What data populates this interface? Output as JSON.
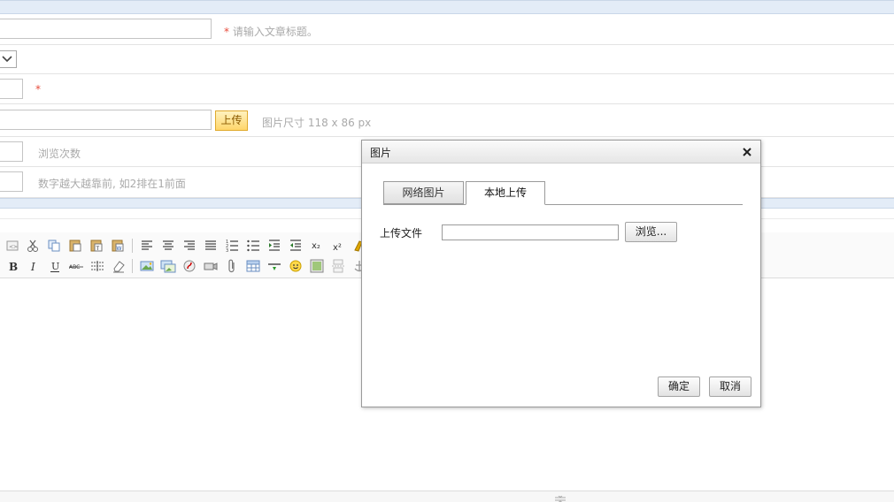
{
  "form": {
    "title_hint_star": "*",
    "title_hint": "请输入文章标题。",
    "sort_required_star": "*",
    "image_upload_button": "上传",
    "image_size_hint": "图片尺寸 118 x 86 px",
    "views_hint": "浏览次数",
    "order_hint": "数字越大越靠前, 如2排在1前面"
  },
  "toolbar": {
    "row1_icons": [
      "source-icon",
      "cut-icon",
      "copy-icon",
      "paste-icon",
      "paste-text-icon",
      "paste-word-icon",
      "align-left-icon",
      "align-center-icon",
      "align-right-icon",
      "justify-icon",
      "ordered-list-icon",
      "unordered-list-icon",
      "indent-icon",
      "outdent-icon",
      "subscript-icon",
      "superscript-icon",
      "clear-format-brush-icon"
    ],
    "row2_icons": [
      "bold-icon",
      "italic-icon",
      "underline-icon",
      "strikethrough-icon",
      "line-height-icon",
      "eraser-icon",
      "insert-image-icon",
      "multi-image-icon",
      "flash-icon",
      "media-icon",
      "attachment-icon",
      "table-icon",
      "horizontal-rule-icon",
      "emoticon-icon",
      "image-gallery-icon",
      "page-break-icon",
      "anchor-icon"
    ],
    "bold_label": "B",
    "italic_label": "I",
    "underline_label": "U",
    "strike_label": "ABC",
    "subscript_label": "x₂",
    "superscript_label": "x²"
  },
  "dialog": {
    "title": "图片",
    "close_glyph": "×",
    "tabs": [
      {
        "label": "网络图片",
        "active": false
      },
      {
        "label": "本地上传",
        "active": true
      }
    ],
    "upload_label": "上传文件",
    "browse_button": "浏览...",
    "ok_button": "确定",
    "cancel_button": "取消"
  },
  "colors": {
    "band": "#e3ecf7",
    "required": "#e74c3c",
    "hint": "#aaaaaa",
    "upload_button": "#ffd66b"
  }
}
